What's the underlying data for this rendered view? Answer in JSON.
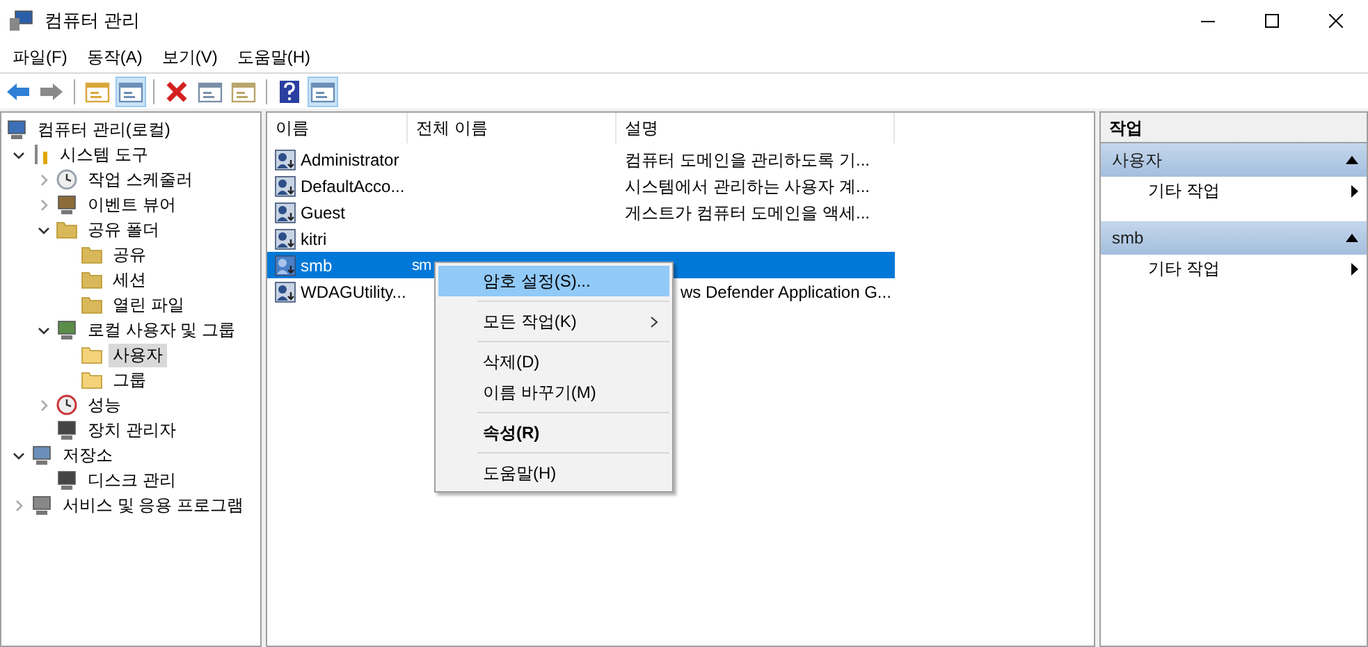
{
  "window": {
    "title": "컴퓨터 관리"
  },
  "menu_bar": [
    "파일(F)",
    "동작(A)",
    "보기(V)",
    "도움말(H)"
  ],
  "toolbar": [
    {
      "pressed": false,
      "disabled": false
    },
    {
      "pressed": false,
      "disabled": true
    },
    {
      "pressed": false,
      "disabled": false
    },
    {
      "pressed": true,
      "disabled": false
    },
    {
      "pressed": false,
      "disabled": false
    },
    {
      "pressed": false,
      "disabled": false
    },
    {
      "pressed": false,
      "disabled": false
    },
    {
      "pressed": false,
      "disabled": false
    },
    {
      "pressed": true,
      "disabled": false
    }
  ],
  "tree": [
    {
      "label": "컴퓨터 관리(로컬)",
      "selected": false,
      "children": [
        {
          "label": "시스템 도구",
          "expanded": true,
          "selected": false,
          "children": [
            {
              "label": "작업 스케줄러",
              "expanded": false,
              "selected": false
            },
            {
              "label": "이벤트 뷰어",
              "expanded": false,
              "selected": false
            },
            {
              "label": "공유 폴더",
              "expanded": true,
              "selected": false,
              "children": [
                {
                  "label": "공유",
                  "selected": false
                },
                {
                  "label": "세션",
                  "selected": false
                },
                {
                  "label": "열린 파일",
                  "selected": false
                }
              ]
            },
            {
              "label": "로컬 사용자 및 그룹",
              "expanded": true,
              "selected": false,
              "children": [
                {
                  "label": "사용자",
                  "selected": true
                },
                {
                  "label": "그룹",
                  "selected": false
                }
              ]
            },
            {
              "label": "성능",
              "expanded": false,
              "selected": false
            },
            {
              "label": "장치 관리자",
              "selected": false
            }
          ]
        },
        {
          "label": "저장소",
          "expanded": true,
          "selected": false,
          "children": [
            {
              "label": "디스크 관리",
              "selected": false
            }
          ]
        },
        {
          "label": "서비스 및 응용 프로그램",
          "expanded": false,
          "selected": false
        }
      ]
    }
  ],
  "table": {
    "columns": [
      "이름",
      "전체 이름",
      "설명"
    ],
    "rows": [
      {
        "name": "Administrator",
        "full_name": "",
        "description": "컴퓨터 도메인을 관리하도록 기...",
        "selected": false
      },
      {
        "name": "DefaultAcco...",
        "full_name": "",
        "description": "시스템에서 관리하는 사용자 계...",
        "selected": false
      },
      {
        "name": "Guest",
        "full_name": "",
        "description": "게스트가 컴퓨터 도메인을 액세...",
        "selected": false
      },
      {
        "name": "kitri",
        "full_name": "",
        "description": "",
        "selected": false
      },
      {
        "name": "smb",
        "full_name": "sm",
        "description": "",
        "selected": true
      },
      {
        "name": "WDAGUtility...",
        "full_name": "",
        "description": "ws Defender Application G...",
        "selected": false
      }
    ]
  },
  "context_menu": {
    "groups": [
      [
        {
          "label": "암호 설정(S)...",
          "selected": true,
          "bold": false,
          "submenu": false
        }
      ],
      [
        {
          "label": "모든 작업(K)",
          "selected": false,
          "bold": false,
          "submenu": true
        }
      ],
      [
        {
          "label": "삭제(D)",
          "selected": false,
          "bold": false,
          "submenu": false
        },
        {
          "label": "이름 바꾸기(M)",
          "selected": false,
          "bold": false,
          "submenu": false
        }
      ],
      [
        {
          "label": "속성(R)",
          "selected": false,
          "bold": true,
          "submenu": false
        }
      ],
      [
        {
          "label": "도움말(H)",
          "selected": false,
          "bold": false,
          "submenu": false
        }
      ]
    ]
  },
  "actions": {
    "title": "작업",
    "sections": [
      {
        "title": "사용자",
        "expanded": true,
        "items": [
          "기타 작업"
        ]
      },
      {
        "title": "smb",
        "expanded": true,
        "items": [
          "기타 작업"
        ]
      }
    ]
  }
}
